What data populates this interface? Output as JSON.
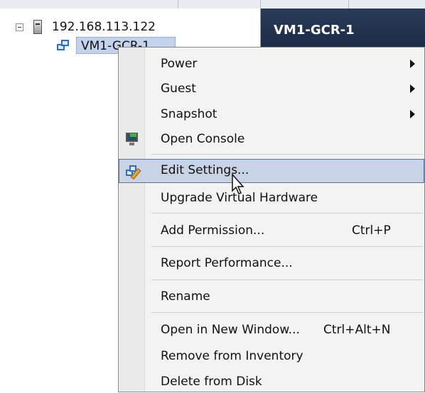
{
  "tree": {
    "host": {
      "label": "192.168.113.122",
      "icon": "server-icon"
    },
    "vm": {
      "label": "VM1-GCR-1",
      "icon": "vm-icon"
    }
  },
  "right_pane": {
    "title": "VM1-GCR-1"
  },
  "context_menu": {
    "items": [
      {
        "label": "Power",
        "submenu": true
      },
      {
        "label": "Guest",
        "submenu": true
      },
      {
        "label": "Snapshot",
        "submenu": true
      },
      {
        "label": "Open Console",
        "icon": "console-icon"
      },
      {
        "label": "Edit Settings...",
        "icon": "edit-settings-icon",
        "highlighted": true
      },
      {
        "label": "Upgrade Virtual Hardware"
      },
      {
        "label": "Add Permission...",
        "shortcut": "Ctrl+P"
      },
      {
        "label": "Report Performance..."
      },
      {
        "label": "Rename"
      },
      {
        "label": "Open in New Window...",
        "shortcut": "Ctrl+Alt+N"
      },
      {
        "label": "Remove from Inventory"
      },
      {
        "label": "Delete from Disk"
      }
    ]
  },
  "colors": {
    "header_bg": "#1b2a44",
    "highlight_bg": "#c9d3e6",
    "selection_bg": "#c3d3ec"
  }
}
